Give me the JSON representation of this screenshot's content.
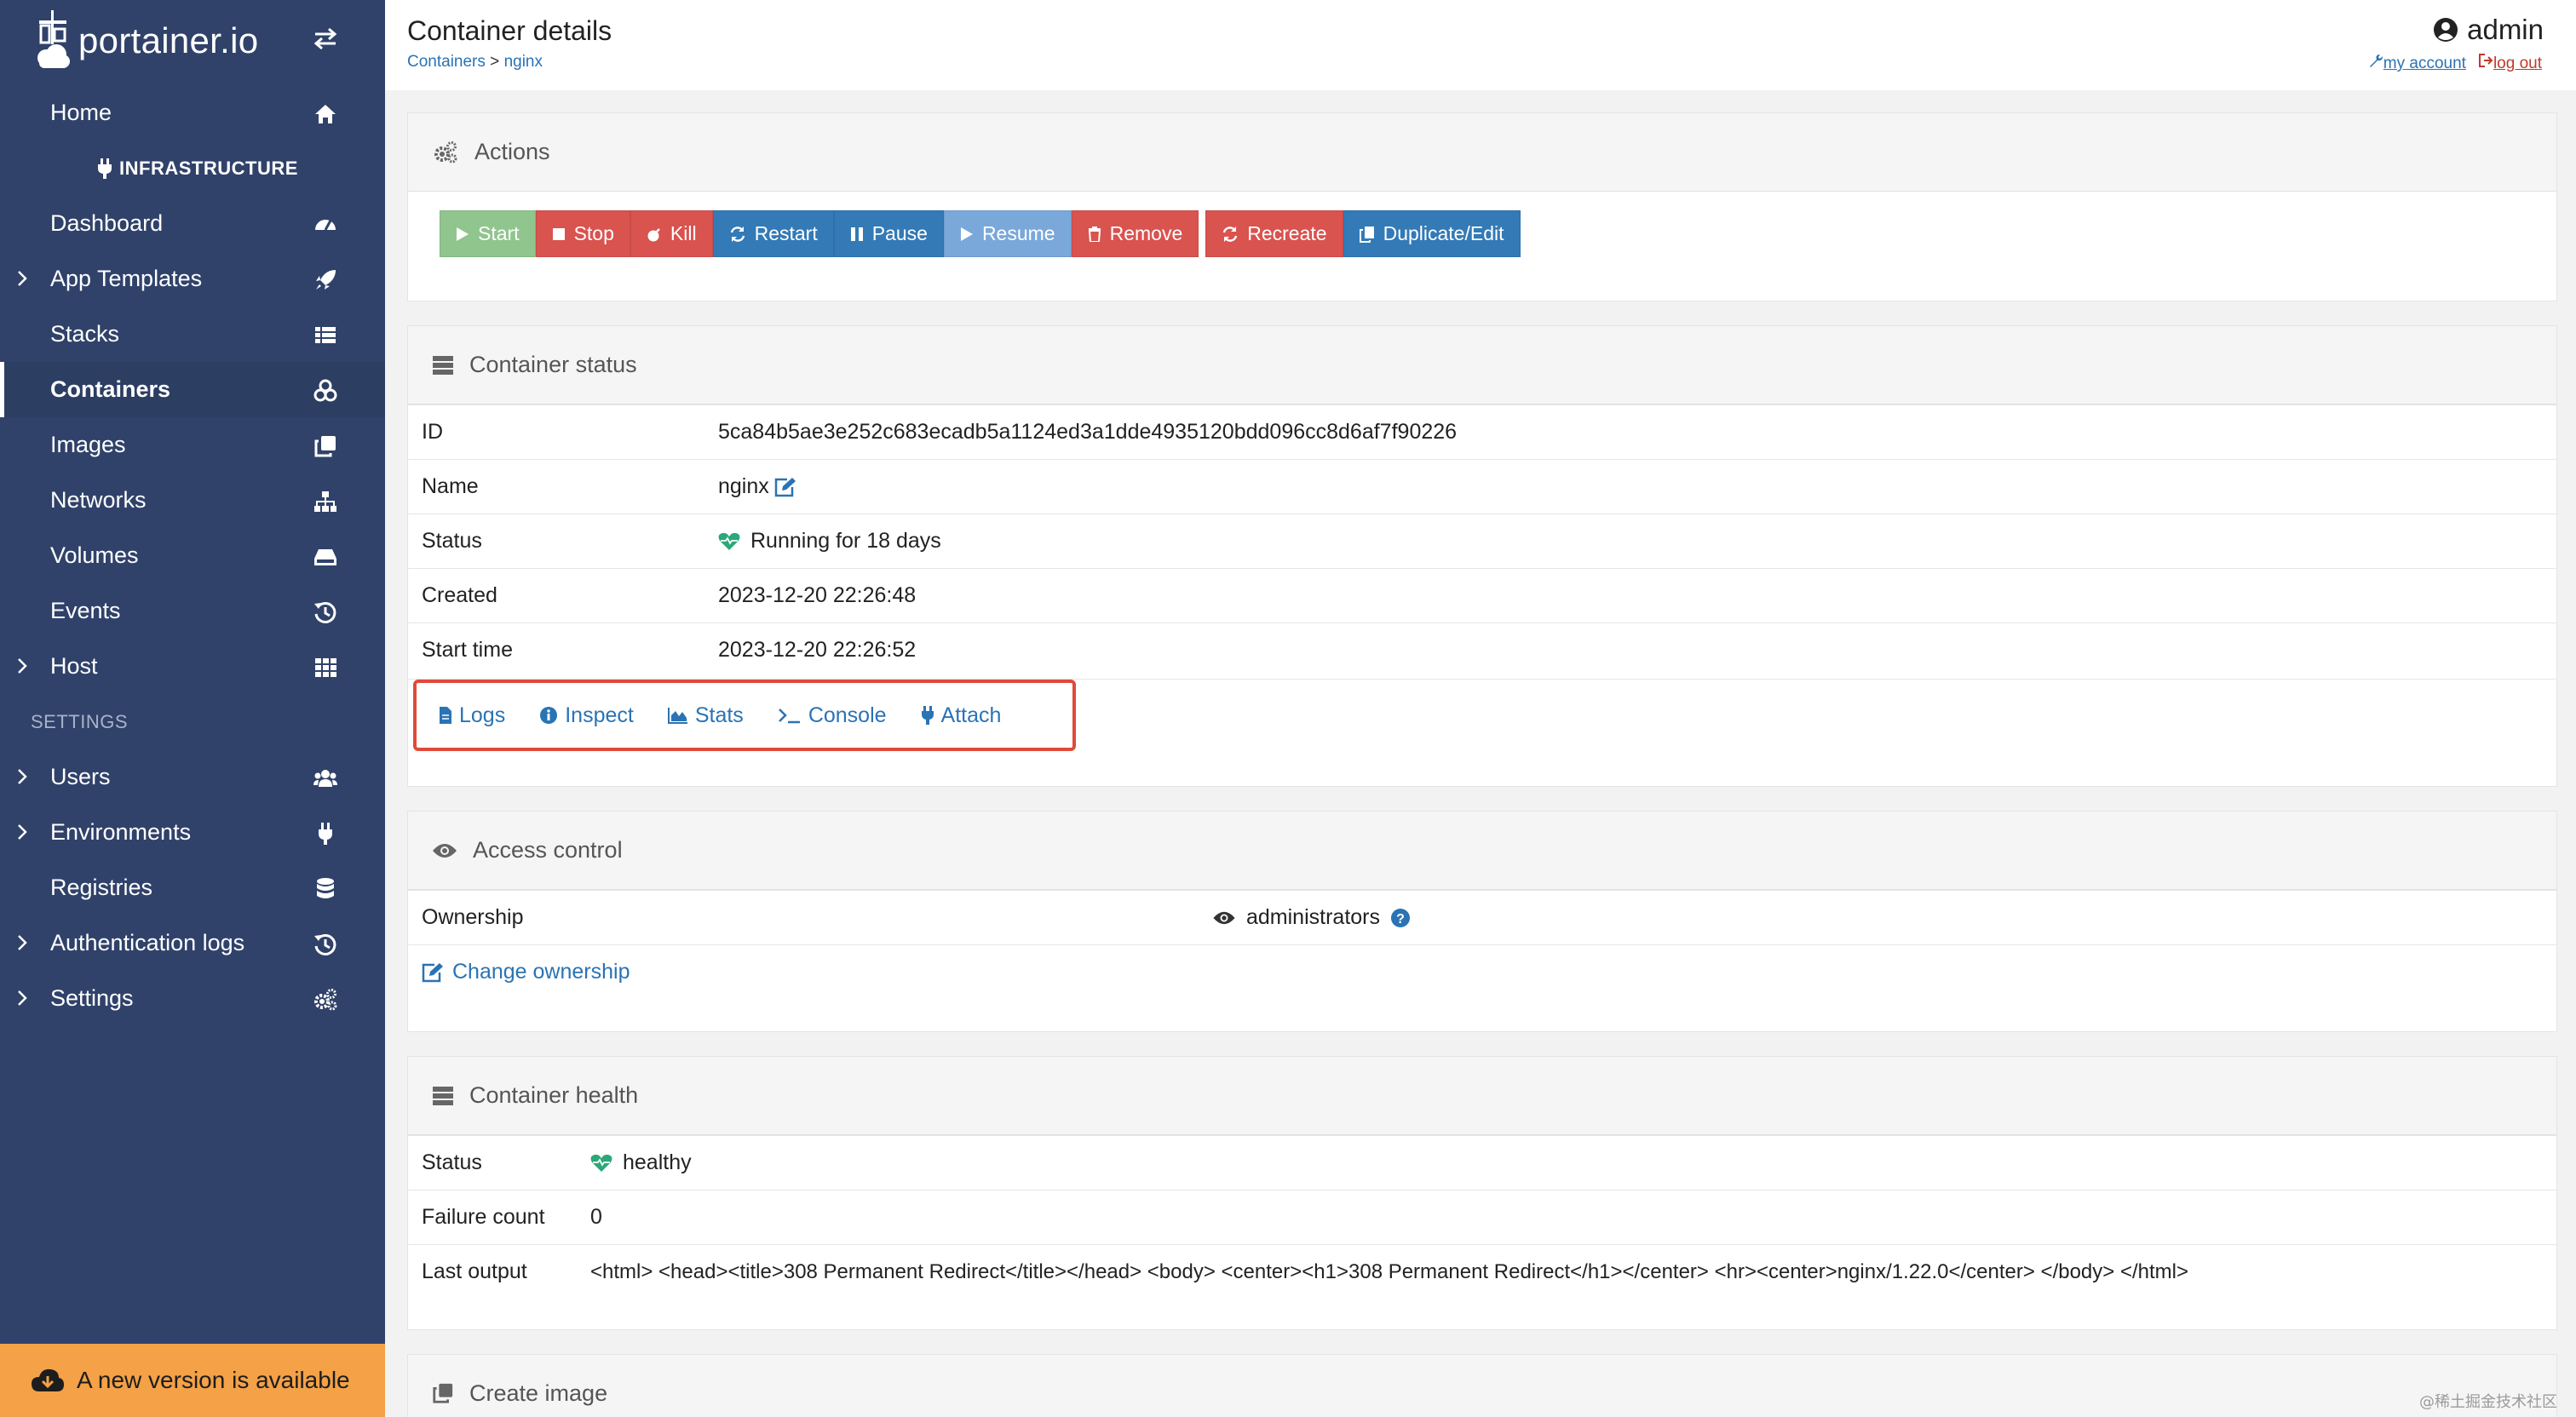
{
  "app": {
    "logo_text": "portainer.io"
  },
  "sidebar": {
    "items": [
      {
        "label": "Home",
        "icon": "home-icon"
      },
      {
        "section": "INFRASTRUCTURE",
        "icon": "plug-icon"
      },
      {
        "label": "Dashboard",
        "icon": "tachometer-icon"
      },
      {
        "label": "App Templates",
        "icon": "rocket-icon",
        "expandable": true
      },
      {
        "label": "Stacks",
        "icon": "th-list-icon"
      },
      {
        "label": "Containers",
        "icon": "cubes-icon",
        "active": true
      },
      {
        "label": "Images",
        "icon": "clone-icon"
      },
      {
        "label": "Networks",
        "icon": "sitemap-icon"
      },
      {
        "label": "Volumes",
        "icon": "hdd-icon"
      },
      {
        "label": "Events",
        "icon": "history-icon"
      },
      {
        "label": "Host",
        "icon": "th-icon",
        "expandable": true
      },
      {
        "section": "SETTINGS"
      },
      {
        "label": "Users",
        "icon": "users-icon",
        "expandable": true
      },
      {
        "label": "Environments",
        "icon": "plug-icon",
        "expandable": true
      },
      {
        "label": "Registries",
        "icon": "database-icon"
      },
      {
        "label": "Authentication logs",
        "icon": "history-icon",
        "expandable": true
      },
      {
        "label": "Settings",
        "icon": "cogs-icon",
        "expandable": true
      }
    ],
    "new_version": "A new version is available"
  },
  "header": {
    "title": "Container details",
    "breadcrumb": {
      "parent": "Containers",
      "sep": ">",
      "current": "nginx"
    },
    "user": "admin",
    "my_account": "my account",
    "log_out": "log out"
  },
  "actions": {
    "title": "Actions",
    "buttons": {
      "start": "Start",
      "stop": "Stop",
      "kill": "Kill",
      "restart": "Restart",
      "pause": "Pause",
      "resume": "Resume",
      "remove": "Remove",
      "recreate": "Recreate",
      "duplicate": "Duplicate/Edit"
    }
  },
  "status": {
    "title": "Container status",
    "id_label": "ID",
    "id": "5ca84b5ae3e252c683ecadb5a1124ed3a1dde4935120bdd096cc8d6af7f90226",
    "name_label": "Name",
    "name": "nginx",
    "status_label": "Status",
    "status": "Running for 18 days",
    "created_label": "Created",
    "created": "2023-12-20 22:26:48",
    "start_label": "Start time",
    "start": "2023-12-20 22:26:52",
    "links": {
      "logs": "Logs",
      "inspect": "Inspect",
      "stats": "Stats",
      "console": "Console",
      "attach": "Attach"
    }
  },
  "access": {
    "title": "Access control",
    "ownership_label": "Ownership",
    "ownership": "administrators",
    "change": "Change ownership"
  },
  "health": {
    "title": "Container health",
    "status_label": "Status",
    "status": "healthy",
    "failure_label": "Failure count",
    "failure": "0",
    "output_label": "Last output",
    "output": "<html> <head><title>308 Permanent Redirect</title></head> <body> <center><h1>308 Permanent Redirect</h1></center> <hr><center>nginx/1.22.0</center> </body> </html>"
  },
  "create_image": {
    "title": "Create image"
  },
  "watermark": "@稀土掘金技术社区",
  "colors": {
    "sidebar": "#30426a",
    "primary": "#337ab7",
    "danger": "#d9534f",
    "success": "#5cb85c",
    "warning": "#f4a147"
  }
}
